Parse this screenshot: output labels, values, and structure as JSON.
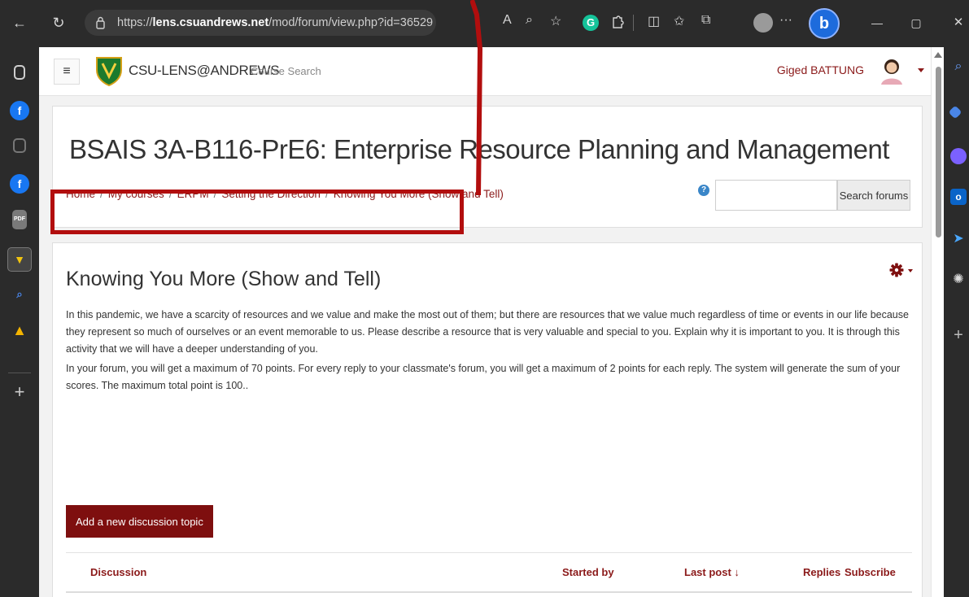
{
  "browser": {
    "url_prefix": "https://",
    "url_host": "lens.csuandrews.net",
    "url_path": "/mod/forum/view.php?id=36529",
    "back_glyph": "←",
    "refresh_glyph": "↻",
    "more_glyph": "···",
    "minimize_glyph": "—",
    "restore_glyph": "▢",
    "close_glyph": "✕",
    "read_aloud_glyph": "A",
    "zoom_glyph": "⌕",
    "favorite_glyph": "☆",
    "grammarly_letter": "G",
    "split_glyph": "◫",
    "favorites_bar_glyph": "✩",
    "collections_glyph": "⧉",
    "bing_letter": "b"
  },
  "site": {
    "menu_glyph": "≡",
    "name": "CSU-LENS@ANDREWS",
    "course_search": "Course Search",
    "user_name": "Giged BATTUNG"
  },
  "course": {
    "title": "BSAIS 3A-B116-PrE6: Enterprise Resource Planning and Management"
  },
  "breadcrumb": {
    "items": [
      "Home",
      "My courses",
      "ERPM",
      "Setting the Direction",
      "Knowing You More (Show and Tell)"
    ],
    "separator": "/"
  },
  "search": {
    "help_glyph": "?",
    "button_label": "Search forums",
    "placeholder": ""
  },
  "forum": {
    "title": "Knowing You More (Show and Tell)",
    "paragraph1": "In this pandemic, we have a scarcity of resources and we value and make the most out of them; but there are resources that we value much regardless of time or events in our life because they represent so much of ourselves or an event memorable to us. Please describe a resource that is very valuable and special to you. Explain why it is important to you. It is through this activity that we will have a deeper understanding of you.",
    "paragraph2": "In your forum, you will get a maximum of 70 points. For every reply to your classmate's forum, you will get a maximum of 2 points for each reply. The system will generate the sum of your scores. The maximum total point is 100..",
    "add_topic_label": "Add a new discussion topic"
  },
  "table": {
    "columns": [
      "Discussion",
      "Started by",
      "Last post ↓",
      "Replies",
      "Subscribe"
    ]
  },
  "sidebar_icons": {
    "left": [
      "tabs-icon",
      "facebook-icon",
      "note-icon",
      "facebook-icon",
      "pdf-icon",
      "csu-app-icon",
      "search-icon",
      "google-drive-icon",
      "add-icon"
    ],
    "right": [
      "search-icon",
      "tools-icon",
      "copilot-icon",
      "outlook-icon",
      "send-icon",
      "games-icon",
      "add-icon"
    ]
  },
  "colors": {
    "accent": "#8b1a1a",
    "button": "#7e0f0f",
    "annotation": "#b20e0e",
    "chrome": "#2b2b2b"
  }
}
